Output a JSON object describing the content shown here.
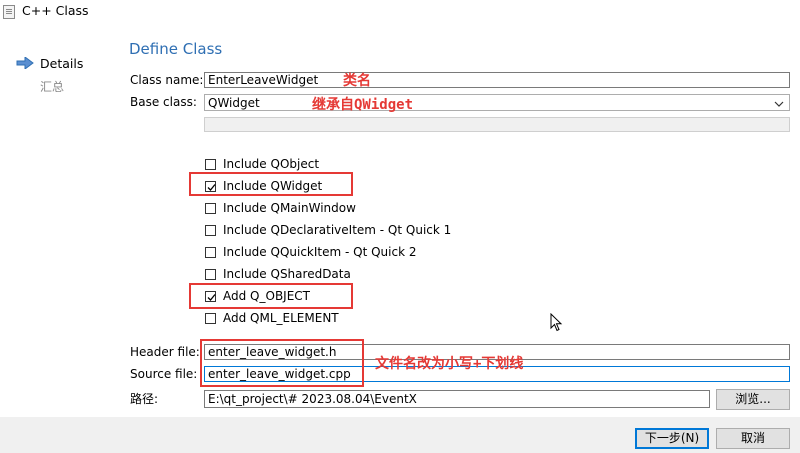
{
  "window": {
    "title": "C++ Class"
  },
  "nav": {
    "details": "Details",
    "summary": "汇总"
  },
  "page": {
    "heading": "Define Class"
  },
  "form": {
    "class_name_label": "Class name:",
    "class_name_value": "EnterLeaveWidget",
    "base_class_label": "Base class:",
    "base_class_value": "QWidget",
    "header_file_label": "Header file:",
    "header_file_value": "enter_leave_widget.h",
    "source_file_label": "Source file:",
    "source_file_value": "enter_leave_widget.cpp",
    "path_label": "路径:",
    "path_value": "E:\\qt_project\\# 2023.08.04\\EventX",
    "browse_label": "浏览..."
  },
  "checkboxes": [
    {
      "label": "Include QObject",
      "checked": false
    },
    {
      "label": "Include QWidget",
      "checked": true
    },
    {
      "label": "Include QMainWindow",
      "checked": false
    },
    {
      "label": "Include QDeclarativeItem - Qt Quick 1",
      "checked": false
    },
    {
      "label": "Include QQuickItem - Qt Quick 2",
      "checked": false
    },
    {
      "label": "Include QSharedData",
      "checked": false
    },
    {
      "label": "Add Q_OBJECT",
      "checked": true
    },
    {
      "label": "Add QML_ELEMENT",
      "checked": false
    }
  ],
  "annotations": {
    "class_name_note": "类名",
    "base_class_note": "继承自QWidget",
    "file_name_note": "文件名改为小写+下划线"
  },
  "buttons": {
    "next": "下一步(N)",
    "cancel": "取消"
  },
  "colors": {
    "accent": "#2f6fb3",
    "annotation": "#e53935",
    "focus": "#0078d7"
  }
}
